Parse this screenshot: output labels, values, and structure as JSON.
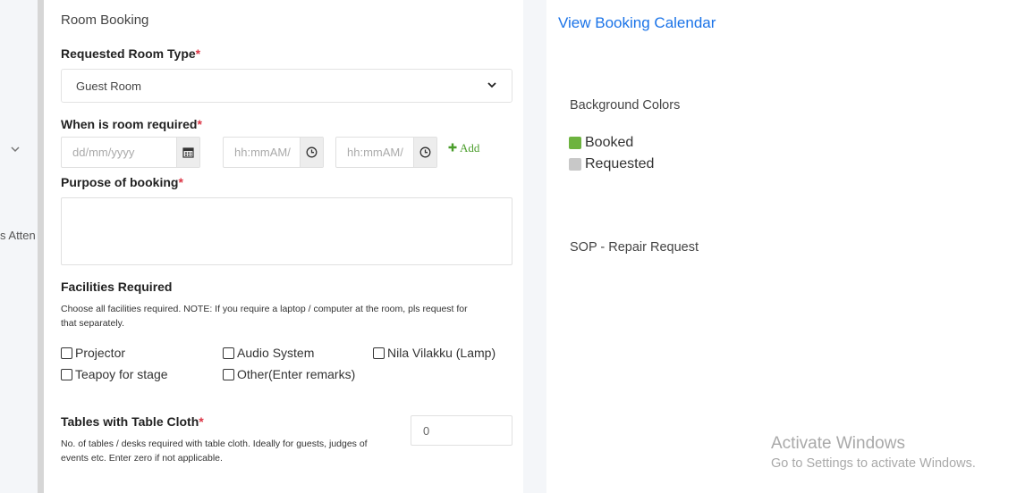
{
  "sidebar": {
    "truncated_item_label": "s Atten"
  },
  "form": {
    "section_title": "Room Booking",
    "room_type": {
      "label": "Requested Room Type",
      "required_mark": "*",
      "selected": "Guest Room"
    },
    "when": {
      "label": "When is room required",
      "required_mark": "*",
      "date_placeholder": "dd/mm/yyyy",
      "start_time_placeholder": "hh:mmAM/",
      "end_time_placeholder": "hh:mmAM/",
      "add_label": "Add"
    },
    "purpose": {
      "label": "Purpose of booking",
      "required_mark": "*"
    },
    "facilities": {
      "label": "Facilities Required",
      "help_line1": "Choose all facilities required. NOTE: If you require a laptop / computer at the room, pls request for",
      "help_line2": "that separately.",
      "options": [
        "Projector",
        "Audio System",
        "Nila Vilakku (Lamp)",
        "Teapoy for stage",
        "Other(Enter remarks)"
      ]
    },
    "tables": {
      "label": "Tables with Table Cloth",
      "required_mark": "*",
      "help_line1": "No. of tables / desks required with table cloth. Ideally for guests, judges of",
      "help_line2": "events etc. Enter zero if not applicable.",
      "value": "0"
    }
  },
  "side": {
    "calendar_link": "View Booking Calendar",
    "legend_title": "Background Colors",
    "legend": [
      {
        "label": "Booked",
        "color": "#6db33f"
      },
      {
        "label": "Requested",
        "color": "#c8c8c8"
      }
    ],
    "sop_title": "SOP - Repair Request"
  },
  "watermark": {
    "title": "Activate Windows",
    "subtitle": "Go to Settings to activate Windows."
  }
}
